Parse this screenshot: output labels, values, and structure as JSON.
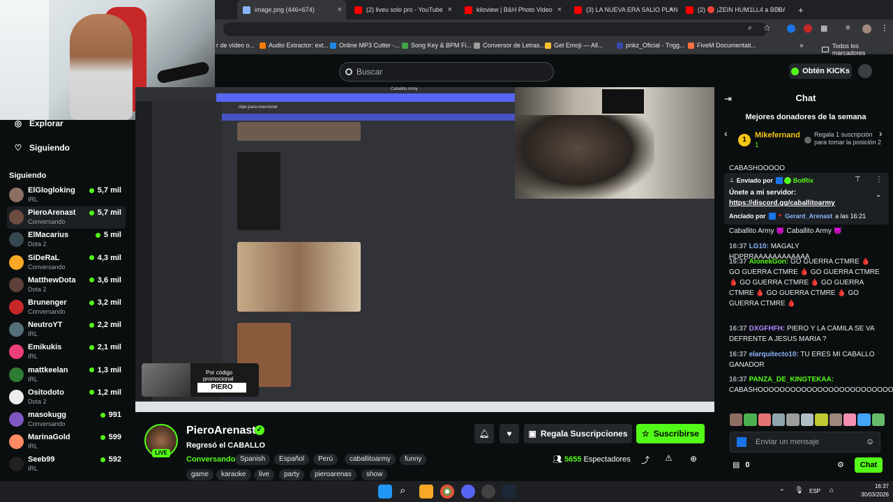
{
  "browser": {
    "tabs": [
      {
        "label": "image.png (446×674)",
        "color": "#8ab4f8"
      },
      {
        "label": "(2) liveu solo pro - YouTube",
        "color": "#ff0000"
      },
      {
        "label": "kiloview | B&H Photo Video",
        "color": "#ff0000"
      },
      {
        "label": "(3) LA NUEVA ERA SALIO PLAN",
        "color": "#ff0000"
      },
      {
        "label": "(2) 🔴 ¡ZEIN HUM1LL4 a BEBA",
        "color": "#ff0000"
      }
    ],
    "new_tab": "+",
    "bookmarks": [
      {
        "label": "r de vídeo o...",
        "color": "#777"
      },
      {
        "label": "Audio Extractor: ext...",
        "color": "#f57c00"
      },
      {
        "label": "Online MP3 Cutter -...",
        "color": "#1e88e5"
      },
      {
        "label": "Song Key & BPM Fi...",
        "color": "#43a047"
      },
      {
        "label": "Conversor de Letras...",
        "color": "#9e9e9e"
      },
      {
        "label": "Get Emoji — All...",
        "color": "#fbc02d"
      },
      {
        "label": "pnkz_Oficial - Trigg...",
        "color": "#3949ab"
      },
      {
        "label": "FiveM Documentati...",
        "color": "#ff7043"
      }
    ],
    "all_bookmarks": "Todos los marcadores"
  },
  "kick": {
    "search_placeholder": "Buscar",
    "kicks_button": "Obtén KICKs"
  },
  "sidebar": {
    "explore": "Explorar",
    "following_nav": "Siguiendo",
    "following_header": "Siguiendo",
    "channels": [
      {
        "name": "ElGlogloking",
        "category": "IRL",
        "viewers": "5,7 mil",
        "color": "#8d6e63"
      },
      {
        "name": "PieroArenast",
        "category": "Conversando",
        "viewers": "5,7 mil",
        "color": "#6d4c41",
        "active": true
      },
      {
        "name": "ElMacarius",
        "category": "Dota 2",
        "viewers": "5 mil",
        "color": "#37474f"
      },
      {
        "name": "SiDeRaL",
        "category": "Conversando",
        "viewers": "4,3 mil",
        "color": "#f9a825"
      },
      {
        "name": "MatthewDota",
        "category": "Dota 2",
        "viewers": "3,6 mil",
        "color": "#5d4037"
      },
      {
        "name": "Brunenger",
        "category": "Conversando",
        "viewers": "3,2 mil",
        "color": "#c62828"
      },
      {
        "name": "NeutroYT",
        "category": "IRL",
        "viewers": "2,2 mil",
        "color": "#546e7a"
      },
      {
        "name": "Emikukis",
        "category": "IRL",
        "viewers": "2,1 mil",
        "color": "#ec407a"
      },
      {
        "name": "mattkeelan",
        "category": "IRL",
        "viewers": "1,3 mil",
        "color": "#2e7d32"
      },
      {
        "name": "Ositodoto",
        "category": "Dota 2",
        "viewers": "1,2 mil",
        "color": "#eeeeee"
      },
      {
        "name": "masokugg",
        "category": "Conversando",
        "viewers": "991",
        "color": "#7e57c2"
      },
      {
        "name": "MarinaGold",
        "category": "IRL",
        "viewers": "599",
        "color": "#ff8a65"
      },
      {
        "name": "Seeb99",
        "category": "IRL",
        "viewers": "592",
        "color": "#212121"
      }
    ]
  },
  "stream": {
    "streamer": "PieroArenast",
    "title": "Regresó el CABALLO",
    "category": "Conversando",
    "live": "LIVE",
    "tags_row1": [
      "Spanish",
      "Español",
      "Perú",
      "caballitoarmy",
      "funny"
    ],
    "tags_row2": [
      "game",
      "karaoke",
      "live",
      "party",
      "pieroarenas",
      "show"
    ],
    "gift_button": "Regala Suscripciones",
    "subscribe_button": "Suscribirse",
    "viewers": "5655",
    "viewers_label": "Espectadores",
    "promo_line1": "Por código",
    "promo_line2": "promocional",
    "promo_code": "PIERO",
    "discord_channel": "clips-para-reaccionar",
    "discord_server": "Caballito Army"
  },
  "chat": {
    "title": "Chat",
    "donors_title": "Mejores donadores de la semana",
    "donor_name": "Mikefernand",
    "donor_count": "1",
    "donor_cta": "Regala 1 suscripción para tomar la posición 2",
    "partial_msg": "CABASHOOOOO",
    "pinned_sender_prefix": "Enviado por",
    "pinned_sender": "BotRix",
    "pinned_text": "Únete a mi servidor:",
    "pinned_link": "https://discord.gg/caballitoarmy",
    "pinned_by_prefix": "Anclado por",
    "pinned_by": "Gerard_Arenast",
    "pinned_time": "a las 16:21",
    "messages": [
      {
        "time": "",
        "user": "",
        "color": "#fff",
        "text": "Caballito Army 😈 Caballito Army 😈"
      },
      {
        "time": "16:37",
        "user": "LG10:",
        "color": "#8ab4f8",
        "text": "MAGALY HDPRRAAAAAAAAAAAA"
      },
      {
        "time": "16:37",
        "user": "AlonekGon:",
        "color": "#53fc18",
        "text": "GO GUERRA CTMRE 🩸 GO GUERRA CTMRE 🩸 GO GUERRA CTMRE 🩸 GO GUERRA CTMRE 🩸 GO GUERRA CTMRE 🩸 GO GUERRA CTMRE 🩸 GO GUERRA CTMRE 🩸"
      },
      {
        "time": "16:37",
        "user": "DXGFHFH:",
        "color": "#b388ff",
        "text": "PIERO Y LA CAMILA SE VA DEFRENTE A JESUS MARIA ?"
      },
      {
        "time": "16:37",
        "user": "elarquitecto10:",
        "color": "#8ab4f8",
        "text": "TU ERES MI CABALLO GANADOR"
      },
      {
        "time": "16:37",
        "user": "PANZA_DE_KINGTEKAA:",
        "color": "#53fc18",
        "text": "CABASHOOOOOOOOOOOOOOOOOOOOOOOOOO"
      }
    ],
    "input_placeholder": "Enviar un mensaje",
    "points": "0",
    "send_button": "Chat"
  },
  "os": {
    "lang": "ESP",
    "time": "16:37",
    "date": "30/03/2026"
  }
}
